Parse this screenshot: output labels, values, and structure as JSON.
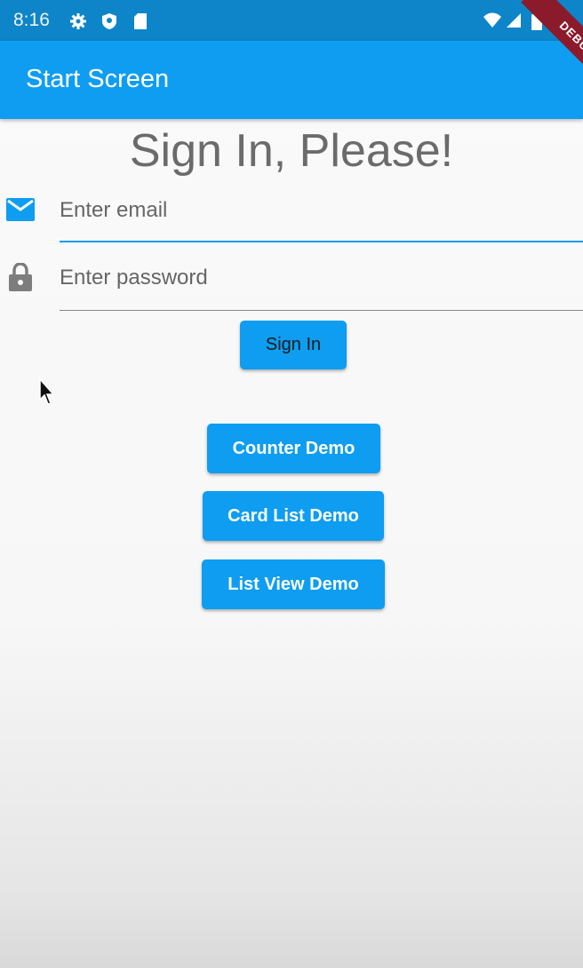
{
  "status_bar": {
    "time": "8:16",
    "icons": [
      "gear-icon",
      "shield-icon",
      "sd-card-icon",
      "wifi-icon",
      "signal-icon",
      "battery-icon"
    ]
  },
  "debug_banner": "DEBUG",
  "app_bar": {
    "title": "Start Screen"
  },
  "main": {
    "heading": "Sign In, Please!",
    "email": {
      "placeholder": "Enter email",
      "value": "",
      "icon": "mail-icon"
    },
    "password": {
      "placeholder": "Enter password",
      "value": "",
      "icon": "lock-icon"
    },
    "sign_in_label": "Sign In",
    "demo_buttons": [
      "Counter Demo",
      "Card List Demo",
      "List View Demo"
    ]
  },
  "colors": {
    "primary": "#0e9df0",
    "status_bar": "#0d85c8",
    "heading_text": "#6b6b6b",
    "debug_banner": "#8b1a2a"
  }
}
